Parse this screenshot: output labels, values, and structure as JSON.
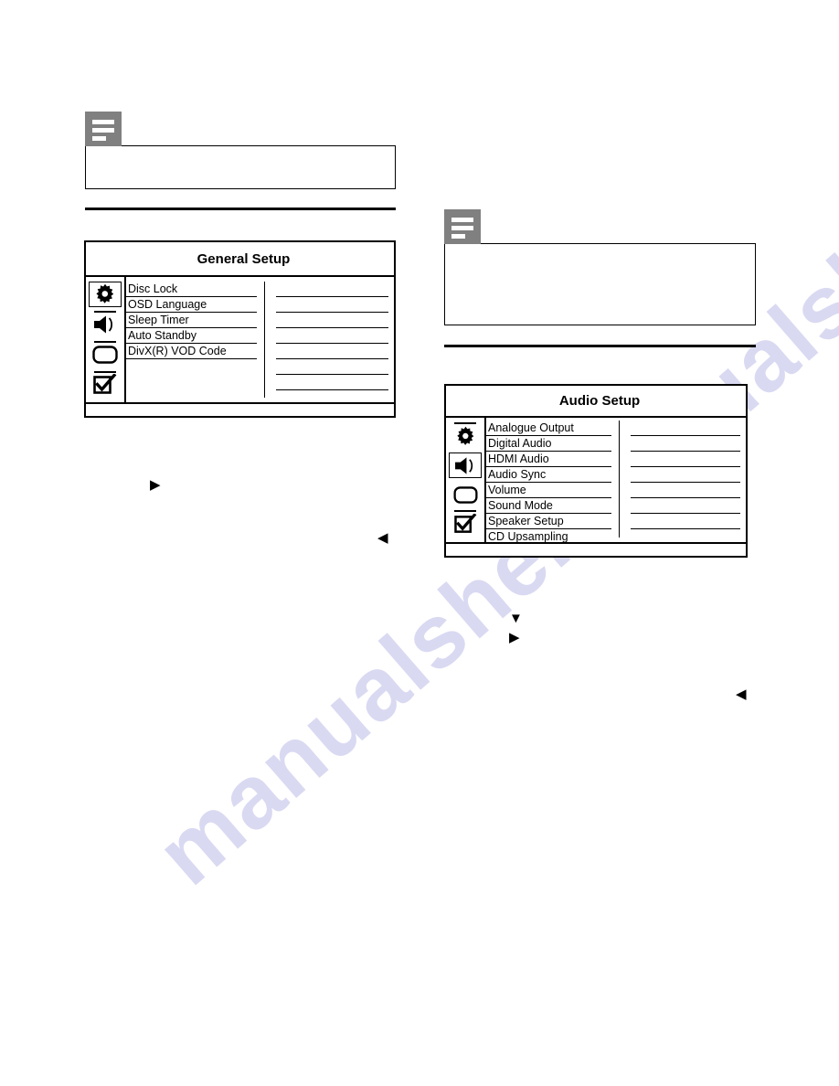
{
  "watermark": {
    "line_a": "manualshelf",
    "line_b": "manualslib.com"
  },
  "notes": [
    {
      "name": "note-left",
      "icon": "note-icon",
      "text": ""
    },
    {
      "name": "note-right",
      "icon": "note-icon",
      "text": ""
    }
  ],
  "panels": {
    "general_setup": {
      "title": "General Setup",
      "rail": [
        {
          "icon": "gear-icon",
          "label": "General Setup",
          "selected": true
        },
        {
          "icon": "speaker-icon",
          "label": "Audio Setup",
          "selected": false
        },
        {
          "icon": "video-screen-icon",
          "label": "Video Setup",
          "selected": false
        },
        {
          "icon": "checkbox-check-icon",
          "label": "Preference Setup",
          "selected": false
        }
      ],
      "items": [
        "Disc Lock",
        "OSD Language",
        "Sleep Timer",
        "Auto Standby",
        "DivX(R) VOD Code"
      ],
      "blank_item_rows": 3,
      "value_rows": 7
    },
    "audio_setup": {
      "title": "Audio Setup",
      "rail": [
        {
          "icon": "gear-icon",
          "label": "General Setup",
          "selected": false
        },
        {
          "icon": "speaker-icon",
          "label": "Audio Setup",
          "selected": true
        },
        {
          "icon": "video-screen-icon",
          "label": "Video Setup",
          "selected": false
        },
        {
          "icon": "checkbox-check-icon",
          "label": "Preference Setup",
          "selected": false
        }
      ],
      "items": [
        "Analogue Output",
        "Digital Audio",
        "HDMI Audio",
        "Audio Sync",
        "Volume",
        "Sound Mode",
        "Speaker Setup",
        "CD Upsampling"
      ],
      "blank_item_rows": 0,
      "value_rows": 7
    }
  },
  "arrows": [
    {
      "name": "arrow-right-step-1",
      "glyph": "▶"
    },
    {
      "name": "arrow-left-step-1",
      "glyph": "◀"
    },
    {
      "name": "arrow-down-step-2",
      "glyph": "▼"
    },
    {
      "name": "arrow-right-step-2",
      "glyph": "▶"
    },
    {
      "name": "arrow-left-step-2",
      "glyph": "◀"
    }
  ],
  "colors": {
    "ink": "#000000",
    "note_icon_bg": "#808080",
    "watermark": "#d9d9f2",
    "page_bg": "#ffffff"
  }
}
